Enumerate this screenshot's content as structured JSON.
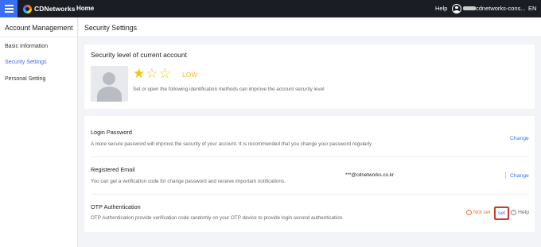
{
  "topbar": {
    "logo_text": "CDNetworks",
    "home_label": "Home",
    "help_label": "Help",
    "account_name": "cdnetworks-cons...",
    "language": "EN"
  },
  "sidebar": {
    "title": "Account Management",
    "items": [
      {
        "label": "Basic Information",
        "active": false
      },
      {
        "label": "Security Settings",
        "active": true
      },
      {
        "label": "Personal Setting",
        "active": false
      }
    ]
  },
  "header": {
    "title": "Security Settings"
  },
  "security_level": {
    "title": "Security level of current account",
    "stars_filled": 1,
    "stars_total": 3,
    "level": "LOW",
    "description": "Set or open the following identification methods can improve the account security level"
  },
  "methods": {
    "login_password": {
      "title": "Login Password",
      "description": "A more secure password will improve the security of your account. It is recommended that you change your password regularly",
      "action": "Change"
    },
    "registered_email": {
      "title": "Registered Email",
      "description": "You can get a verification code for change password and receive important notifications.",
      "value": "***@cdnetworks.co.kr",
      "action": "Change"
    },
    "otp": {
      "title": "OTP Authentication",
      "description": "OTP Authentication provide verification code randomly on your OTP device to provide login second authentication.",
      "status": "Not set",
      "action": "set",
      "help": "Help"
    }
  },
  "colors": {
    "accent": "#3b6ff5",
    "topbar": "#1b1d24",
    "warning": "#e8743b",
    "star": "#f5c518",
    "highlight_border": "#d9342b"
  }
}
